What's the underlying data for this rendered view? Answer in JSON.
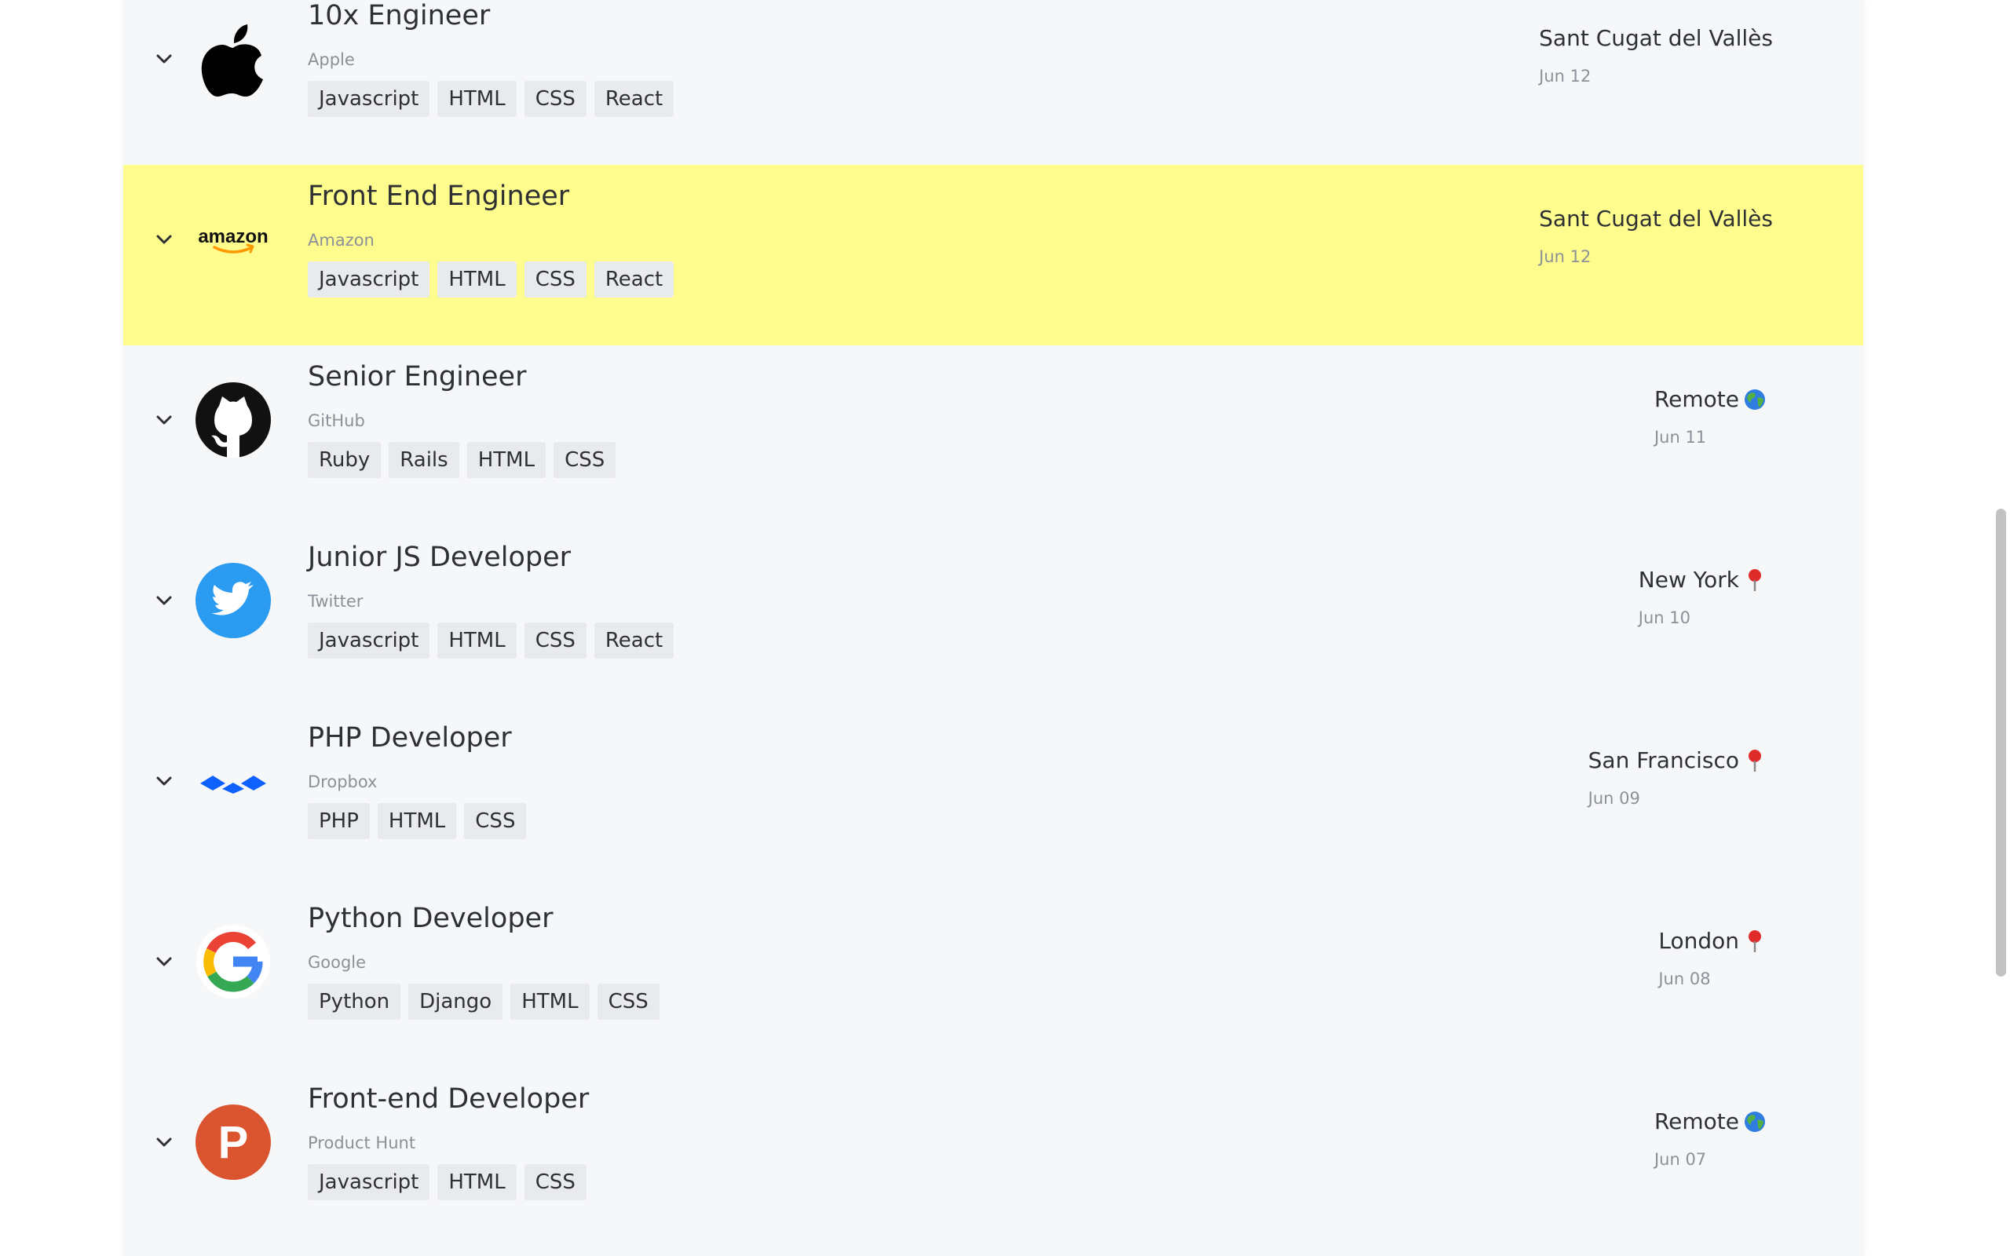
{
  "jobs": [
    {
      "title": "10x Engineer",
      "company": "Apple",
      "tags": [
        "Javascript",
        "HTML",
        "CSS",
        "React"
      ],
      "location": "Sant Cugat del Vallès",
      "location_icon": "",
      "date": "Jun 12",
      "logo": "apple-logo",
      "highlighted": false
    },
    {
      "title": "Front End Engineer",
      "company": "Amazon",
      "tags": [
        "Javascript",
        "HTML",
        "CSS",
        "React"
      ],
      "location": "Sant Cugat del Vallès",
      "location_icon": "",
      "date": "Jun 12",
      "logo": "amazon-logo",
      "logo_text": "amazon",
      "highlighted": true
    },
    {
      "title": "Senior Engineer",
      "company": "GitHub",
      "tags": [
        "Ruby",
        "Rails",
        "HTML",
        "CSS"
      ],
      "location": "Remote",
      "location_icon": "globe-icon",
      "date": "Jun 11",
      "logo": "github-logo",
      "highlighted": false
    },
    {
      "title": "Junior JS Developer",
      "company": "Twitter",
      "tags": [
        "Javascript",
        "HTML",
        "CSS",
        "React"
      ],
      "location": "New York",
      "location_icon": "pin-icon",
      "date": "Jun 10",
      "logo": "twitter-logo",
      "highlighted": false
    },
    {
      "title": "PHP Developer",
      "company": "Dropbox",
      "tags": [
        "PHP",
        "HTML",
        "CSS"
      ],
      "location": "San Francisco",
      "location_icon": "pin-icon",
      "date": "Jun 09",
      "logo": "dropbox-logo",
      "highlighted": false
    },
    {
      "title": "Python Developer",
      "company": "Google",
      "tags": [
        "Python",
        "Django",
        "HTML",
        "CSS"
      ],
      "location": "London",
      "location_icon": "pin-icon",
      "date": "Jun 08",
      "logo": "google-logo",
      "highlighted": false
    },
    {
      "title": "Front-end Developer",
      "company": "Product Hunt",
      "tags": [
        "Javascript",
        "HTML",
        "CSS"
      ],
      "location": "Remote",
      "location_icon": "globe-icon",
      "date": "Jun 07",
      "logo": "producthunt-logo",
      "logo_text": "P",
      "highlighted": false
    }
  ],
  "colors": {
    "highlight": "#fdfc8d",
    "panel": "#f6f7f9",
    "tag_bg": "#e9eaee",
    "muted": "#8c9098",
    "text": "#2e3033"
  }
}
